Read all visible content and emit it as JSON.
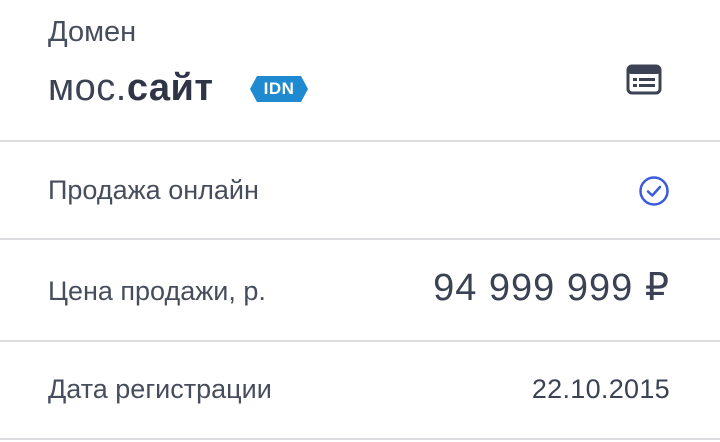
{
  "domain": {
    "label": "Домен",
    "name_prefix": "мос.",
    "name_zone": "сайт",
    "badge": "IDN",
    "badge_color": "#1f8ad0",
    "whois_icon": "document-window-icon"
  },
  "rows": [
    {
      "label": "Продажа онлайн",
      "icon": "check-circle-icon",
      "icon_color": "#3b5bdb"
    },
    {
      "label": "Цена продажи, р.",
      "value": "94 999 999 ₽"
    },
    {
      "label": "Дата регистрации",
      "value": "22.10.2015"
    }
  ],
  "colors": {
    "text": "#3b4253",
    "divider": "#dcdde1"
  }
}
